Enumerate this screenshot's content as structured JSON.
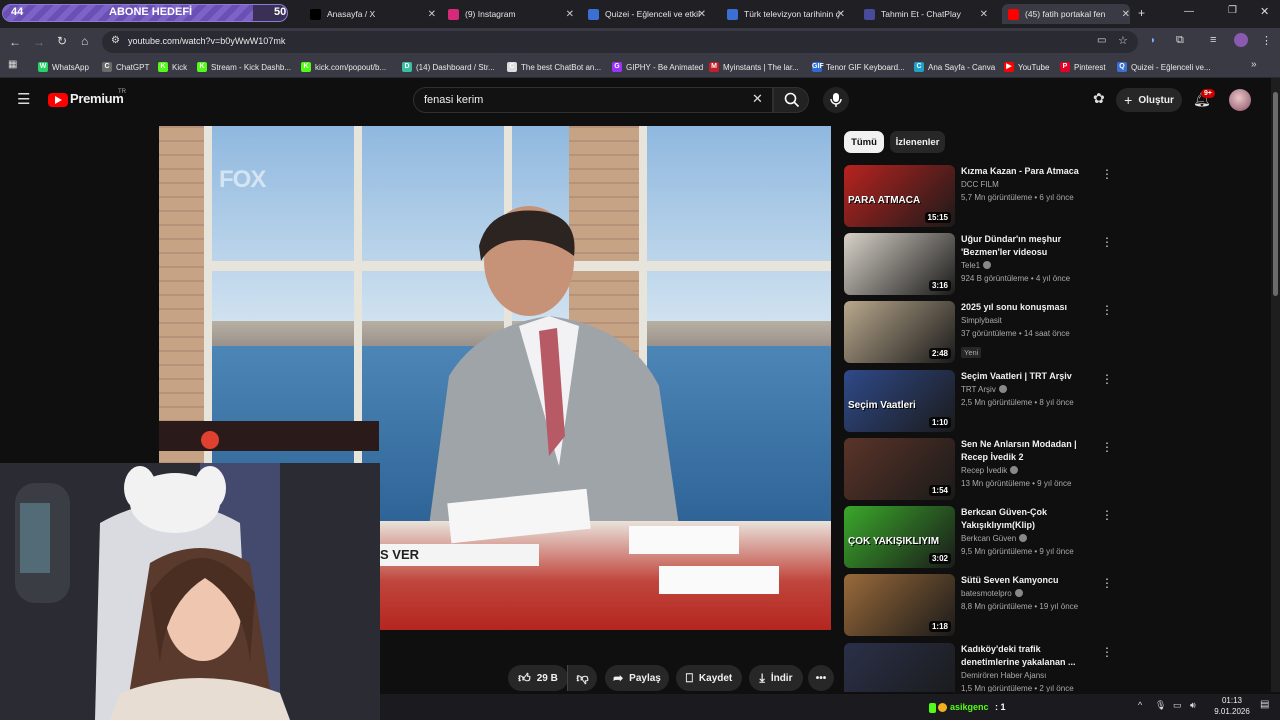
{
  "browser": {
    "sub_goal": {
      "current": "44",
      "label": "ABONE HEDEFİ",
      "target": "50",
      "progress": 0.88
    },
    "tabs": [
      {
        "label": "Anasayfa / X",
        "icon": "x-logo-icon",
        "color": "#000000"
      },
      {
        "label": "(9) Instagram",
        "icon": "instagram-icon",
        "color": "#d6297a"
      },
      {
        "label": "Quizei - Eğlenceli ve etkil",
        "icon": "quizei-icon",
        "color": "#3b6fd4"
      },
      {
        "label": "Türk televizyon tarihinin ç",
        "icon": "quizei-icon",
        "color": "#3b6fd4"
      },
      {
        "label": "Tahmin Et - ChatPlay",
        "icon": "chatplay-icon",
        "color": "#4a4a9a"
      },
      {
        "label": "(45) fatih portakal fen",
        "icon": "youtube-icon",
        "color": "#ff0000"
      }
    ],
    "url": "youtube.com/watch?v=b0yWwW107mk",
    "bookmarks": [
      {
        "label": "WhatsApp",
        "color": "#25d366",
        "letter": "W"
      },
      {
        "label": "ChatGPT",
        "color": "#6b6b6b",
        "letter": "C"
      },
      {
        "label": "Kick",
        "color": "#53fc18",
        "letter": "K"
      },
      {
        "label": "Stream - Kick Dashb...",
        "color": "#53fc18",
        "letter": "K"
      },
      {
        "label": "kick.com/popout/b...",
        "color": "#53fc18",
        "letter": "K"
      },
      {
        "label": "(14) Dashboard / Str...",
        "color": "#39c0a0",
        "letter": "D"
      },
      {
        "label": "The best ChatBot an...",
        "color": "#dddddd",
        "letter": "C"
      },
      {
        "label": "GIPHY - Be Animated",
        "color": "#9933ff",
        "letter": "G"
      },
      {
        "label": "Myinstants | The lar...",
        "color": "#c0202a",
        "letter": "M"
      },
      {
        "label": "Tenor GIF Keyboard...",
        "color": "#2e6bd6",
        "letter": "GIF"
      },
      {
        "label": "Ana Sayfa - Canva",
        "color": "#1fa0c8",
        "letter": "C"
      },
      {
        "label": "YouTube",
        "color": "#ff0000",
        "letter": "▶"
      },
      {
        "label": "Pinterest",
        "color": "#e60023",
        "letter": "P"
      },
      {
        "label": "Quizei - Eğlenceli ve...",
        "color": "#3b6fd4",
        "letter": "Q"
      }
    ]
  },
  "youtube": {
    "logo": "Premium",
    "logo_sup": "TR",
    "search_value": "fenasi kerim",
    "create_label": "Oluştur",
    "notif_count": "9+",
    "video_overlay": {
      "ticker": "S VER",
      "watermark": "FOX"
    },
    "actions": {
      "likes": "29 B",
      "share": "Paylaş",
      "save": "Kaydet",
      "download": "İndir"
    },
    "chips": [
      "Tümü",
      "İzlenenler"
    ],
    "recommendations": [
      {
        "title": "Kızma Kazan - Para Atmaca",
        "channel": "DCC FILM",
        "verified": false,
        "meta": "5,7 Mn görüntüleme • 6 yıl önce",
        "duration": "15:15",
        "badge": "",
        "thumb_text": "PARA ATMACA",
        "thumb_color": "#b8231f"
      },
      {
        "title": "Uğur Dündar'ın meşhur 'Bezmen'ler videosu",
        "channel": "Tele1",
        "verified": true,
        "meta": "924 B görüntüleme • 4 yıl önce",
        "duration": "3:16",
        "badge": "",
        "thumb_text": "",
        "thumb_color": "#d8d2c8"
      },
      {
        "title": "2025 yıl sonu konuşması",
        "channel": "Simplybasit",
        "verified": false,
        "meta": "37 görüntüleme • 14 saat önce",
        "duration": "2:48",
        "badge": "Yeni",
        "thumb_text": "",
        "thumb_color": "#b9a88d"
      },
      {
        "title": "Seçim Vaatleri | TRT Arşiv",
        "channel": "TRT Arşiv",
        "verified": true,
        "meta": "2,5 Mn görüntüleme • 8 yıl önce",
        "duration": "1:10",
        "badge": "",
        "thumb_text": "Seçim Vaatleri",
        "thumb_color": "#2f4a8a"
      },
      {
        "title": "Sen Ne Anlarsın Modadan | Recep İvedik 2",
        "channel": "Recep İvedik",
        "verified": true,
        "meta": "13 Mn görüntüleme • 9 yıl önce",
        "duration": "1:54",
        "badge": "",
        "thumb_text": "",
        "thumb_color": "#5a3428"
      },
      {
        "title": "Berkcan Güven-Çok Yakışıklıyım(Klip)",
        "channel": "Berkcan Güven",
        "verified": true,
        "meta": "9,5 Mn görüntüleme • 9 yıl önce",
        "duration": "3:02",
        "badge": "",
        "thumb_text": "ÇOK YAKIŞIKLIYIM",
        "thumb_color": "#3aa82a"
      },
      {
        "title": "Sütü Seven Kamyoncu",
        "channel": "batesmotelpro",
        "verified": true,
        "meta": "8,8 Mn görüntüleme • 19 yıl önce",
        "duration": "1:18",
        "badge": "",
        "thumb_text": "",
        "thumb_color": "#9a6a3a"
      },
      {
        "title": "Kadıköy'deki trafik denetimlerine yakalanan ...",
        "channel": "Demirören Haber Ajansı",
        "verified": false,
        "meta": "1,5 Mn görüntüleme • 2 yıl önce",
        "duration": "",
        "badge": "",
        "thumb_text": "",
        "thumb_color": "#2a3048"
      }
    ]
  },
  "taskbar": {
    "chat_user": "asikgenc",
    "chat_count": ": 1",
    "time": "01:13",
    "date": "9.01.2026"
  },
  "colors": {
    "accent": "#ff0000",
    "bg": "#0f0f0f",
    "sub_goal": "#7d62c8"
  }
}
